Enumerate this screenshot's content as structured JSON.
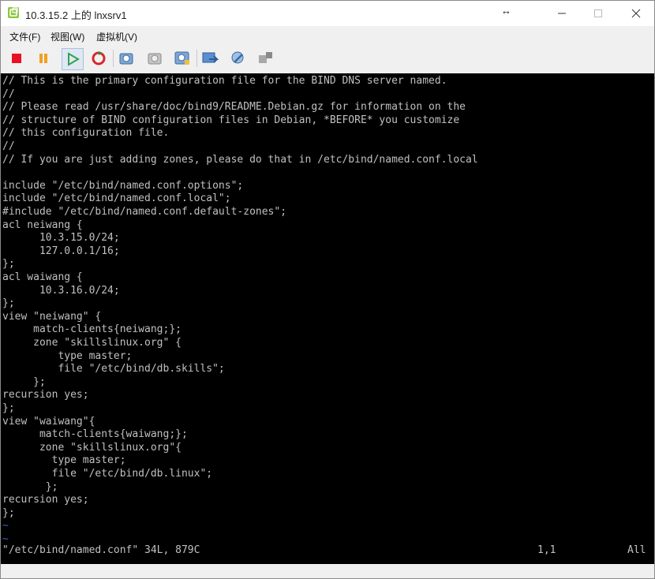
{
  "window": {
    "title": "10.3.15.2 上的 lnxsrv1",
    "resize_glyph": "↔"
  },
  "menu": [
    "文件(F)",
    "视图(W)",
    "虚拟机(V)"
  ],
  "toolbar": {
    "buttons": [
      "stop-icon",
      "pause-icon",
      "play-icon",
      "reset-icon",
      "snapshot-icon",
      "revert-icon",
      "snapshot-manager-icon",
      "console-settings-icon",
      "tools-icon",
      "network-icon"
    ]
  },
  "console": {
    "lines": [
      "// This is the primary configuration file for the BIND DNS server named.",
      "//",
      "// Please read /usr/share/doc/bind9/README.Debian.gz for information on the",
      "// structure of BIND configuration files in Debian, *BEFORE* you customize",
      "// this configuration file.",
      "//",
      "// If you are just adding zones, please do that in /etc/bind/named.conf.local",
      "",
      "include \"/etc/bind/named.conf.options\";",
      "include \"/etc/bind/named.conf.local\";",
      "#include \"/etc/bind/named.conf.default-zones\";",
      "acl neiwang {",
      "      10.3.15.0/24;",
      "      127.0.0.1/16;",
      "};",
      "acl waiwang {",
      "      10.3.16.0/24;",
      "};",
      "view \"neiwang\" {",
      "     match-clients{neiwang;};",
      "     zone \"skillslinux.org\" {",
      "         type master;",
      "         file \"/etc/bind/db.skills\";",
      "     };",
      "recursion yes;",
      "};",
      "view \"waiwang\"{",
      "      match-clients{waiwang;};",
      "      zone \"skillslinux.org\"{",
      "        type master;",
      "        file \"/etc/bind/db.linux\";",
      "       };",
      "recursion yes;",
      "};",
      "~",
      "~"
    ],
    "status_file": "\"/etc/bind/named.conf\" 34L, 879C",
    "status_pos": "1,1",
    "status_view": "All"
  },
  "colors": {
    "console_bg": "#000000",
    "console_text": "#c0c0c0",
    "tilde": "#3b5fc0",
    "stop_red": "#e81123",
    "pause_orange": "#f0a020",
    "play_green": "#2ea44f"
  }
}
